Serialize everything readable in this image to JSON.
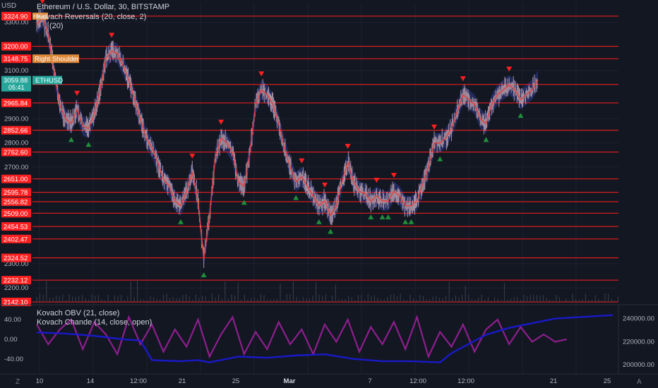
{
  "header": {
    "currency": "USD",
    "symbol_line": "Ethereum / U.S. Dollar, 30, BITSTAMP",
    "indicator_line": "Kovach Reversals (20, close, 2)",
    "indicator_line2": "(20)"
  },
  "osc_legend": {
    "line1": "Kovach OBV (21, close)",
    "line2": "Kovach Chande (14, close, open)"
  },
  "colors": {
    "background": "#131722",
    "level_line": "#ff1f1f",
    "price_label_bg": "#ff1f1f",
    "band": "#2a3b8f",
    "candle": "#c8a8b0",
    "ma": "#e0403a",
    "arrow_down": "#ff1f1f",
    "arrow_up": "#1f8f3a",
    "current_price_bg": "#26a69a",
    "shoulder_label_bg": "#e08a3a",
    "obv_line": "#1919c8",
    "chande_line": "#8e1e8e",
    "grid": "#1e2230"
  },
  "price_levels": [
    3324.9,
    3200.0,
    3148.75,
    3042.18,
    2965.84,
    2852.66,
    2762.6,
    2651.0,
    2595.78,
    2556.82,
    2509.0,
    2454.53,
    2402.47,
    2324.52,
    2232.12,
    2142.1
  ],
  "price_ticks": [
    "3300.00",
    "3100.00",
    "2900.00",
    "2800.00",
    "2700.00",
    "2300.00",
    "2200.00"
  ],
  "current_price": {
    "value": "3059.88",
    "countdown": "05:41",
    "ticker": "ETHUSD"
  },
  "annotations": {
    "head": "Head",
    "right_shoulder": "Right Shoulder"
  },
  "osc_ticks": {
    "left": [
      "40.00",
      "0.00",
      "-40.00"
    ],
    "right": [
      "240000.00",
      "220000.00",
      "200000.00"
    ]
  },
  "time_axis": [
    "10",
    "14",
    "12:00",
    "21",
    "25",
    "Mar",
    "7",
    "12:00",
    "12:00",
    "21",
    "25"
  ],
  "corner": {
    "left": "Z",
    "right": "A"
  },
  "chart_data": {
    "type": "line",
    "title": "Ethereum / U.S. Dollar, 30, BITSTAMP",
    "x_range": [
      0,
      100
    ],
    "y_range": [
      2142,
      3380
    ],
    "price_path": [
      [
        0,
        3290
      ],
      [
        1,
        3320
      ],
      [
        2,
        3250
      ],
      [
        3,
        3100
      ],
      [
        4,
        2960
      ],
      [
        5,
        2900
      ],
      [
        6,
        2880
      ],
      [
        7,
        2940
      ],
      [
        8,
        2870
      ],
      [
        9,
        2860
      ],
      [
        10,
        2920
      ],
      [
        11,
        3020
      ],
      [
        12,
        3150
      ],
      [
        13,
        3180
      ],
      [
        14,
        3170
      ],
      [
        15,
        3120
      ],
      [
        16,
        3060
      ],
      [
        17,
        2980
      ],
      [
        18,
        2900
      ],
      [
        19,
        2820
      ],
      [
        20,
        2780
      ],
      [
        21,
        2720
      ],
      [
        22,
        2650
      ],
      [
        23,
        2620
      ],
      [
        24,
        2560
      ],
      [
        25,
        2540
      ],
      [
        26,
        2600
      ],
      [
        27,
        2680
      ],
      [
        28,
        2560
      ],
      [
        29,
        2320
      ],
      [
        30,
        2500
      ],
      [
        31,
        2740
      ],
      [
        32,
        2820
      ],
      [
        33,
        2800
      ],
      [
        34,
        2760
      ],
      [
        35,
        2640
      ],
      [
        36,
        2620
      ],
      [
        37,
        2760
      ],
      [
        38,
        2960
      ],
      [
        39,
        3020
      ],
      [
        40,
        3000
      ],
      [
        41,
        2960
      ],
      [
        42,
        2880
      ],
      [
        43,
        2780
      ],
      [
        44,
        2700
      ],
      [
        45,
        2640
      ],
      [
        46,
        2660
      ],
      [
        47,
        2620
      ],
      [
        48,
        2580
      ],
      [
        49,
        2540
      ],
      [
        50,
        2560
      ],
      [
        51,
        2500
      ],
      [
        52,
        2540
      ],
      [
        53,
        2640
      ],
      [
        54,
        2720
      ],
      [
        55,
        2640
      ],
      [
        56,
        2600
      ],
      [
        57,
        2590
      ],
      [
        58,
        2560
      ],
      [
        59,
        2580
      ],
      [
        60,
        2560
      ],
      [
        61,
        2560
      ],
      [
        62,
        2600
      ],
      [
        63,
        2580
      ],
      [
        64,
        2540
      ],
      [
        65,
        2540
      ],
      [
        66,
        2560
      ],
      [
        67,
        2630
      ],
      [
        68,
        2700
      ],
      [
        69,
        2800
      ],
      [
        70,
        2800
      ],
      [
        71,
        2820
      ],
      [
        72,
        2860
      ],
      [
        73,
        2930
      ],
      [
        74,
        3000
      ],
      [
        75,
        2980
      ],
      [
        76,
        2960
      ],
      [
        77,
        2900
      ],
      [
        78,
        2880
      ],
      [
        79,
        2960
      ],
      [
        80,
        3000
      ],
      [
        81,
        3020
      ],
      [
        82,
        3040
      ],
      [
        83,
        3020
      ],
      [
        84,
        2980
      ],
      [
        85,
        3000
      ],
      [
        86,
        3020
      ],
      [
        87,
        3060
      ]
    ],
    "obv_path": [
      [
        0,
        228000
      ],
      [
        5,
        227000
      ],
      [
        10,
        225000
      ],
      [
        15,
        222000
      ],
      [
        18,
        221000
      ],
      [
        20,
        204000
      ],
      [
        25,
        203000
      ],
      [
        28,
        204000
      ],
      [
        30,
        202000
      ],
      [
        35,
        207000
      ],
      [
        40,
        206000
      ],
      [
        45,
        208000
      ],
      [
        50,
        209000
      ],
      [
        55,
        205000
      ],
      [
        60,
        203000
      ],
      [
        65,
        203000
      ],
      [
        70,
        202000
      ],
      [
        72,
        210000
      ],
      [
        75,
        218000
      ],
      [
        78,
        226000
      ],
      [
        82,
        232000
      ],
      [
        85,
        235000
      ],
      [
        90,
        240000
      ],
      [
        100,
        243000
      ]
    ],
    "chande_path": [
      [
        0,
        30
      ],
      [
        2,
        -10
      ],
      [
        4,
        20
      ],
      [
        6,
        40
      ],
      [
        8,
        -20
      ],
      [
        10,
        35
      ],
      [
        12,
        10
      ],
      [
        14,
        -30
      ],
      [
        16,
        45
      ],
      [
        18,
        -10
      ],
      [
        20,
        30
      ],
      [
        22,
        -25
      ],
      [
        24,
        20
      ],
      [
        26,
        -15
      ],
      [
        28,
        40
      ],
      [
        30,
        -35
      ],
      [
        32,
        10
      ],
      [
        34,
        45
      ],
      [
        36,
        -30
      ],
      [
        38,
        15
      ],
      [
        40,
        -20
      ],
      [
        42,
        35
      ],
      [
        44,
        -10
      ],
      [
        46,
        20
      ],
      [
        48,
        -30
      ],
      [
        50,
        30
      ],
      [
        52,
        -5
      ],
      [
        54,
        40
      ],
      [
        56,
        -25
      ],
      [
        58,
        25
      ],
      [
        60,
        -10
      ],
      [
        62,
        35
      ],
      [
        64,
        -20
      ],
      [
        66,
        45
      ],
      [
        68,
        -35
      ],
      [
        70,
        15
      ],
      [
        72,
        -15
      ],
      [
        74,
        30
      ],
      [
        76,
        -25
      ],
      [
        78,
        20
      ],
      [
        80,
        40
      ],
      [
        82,
        -10
      ],
      [
        84,
        25
      ],
      [
        86,
        -5
      ],
      [
        88,
        10
      ],
      [
        90,
        -5
      ],
      [
        92,
        0
      ]
    ]
  }
}
